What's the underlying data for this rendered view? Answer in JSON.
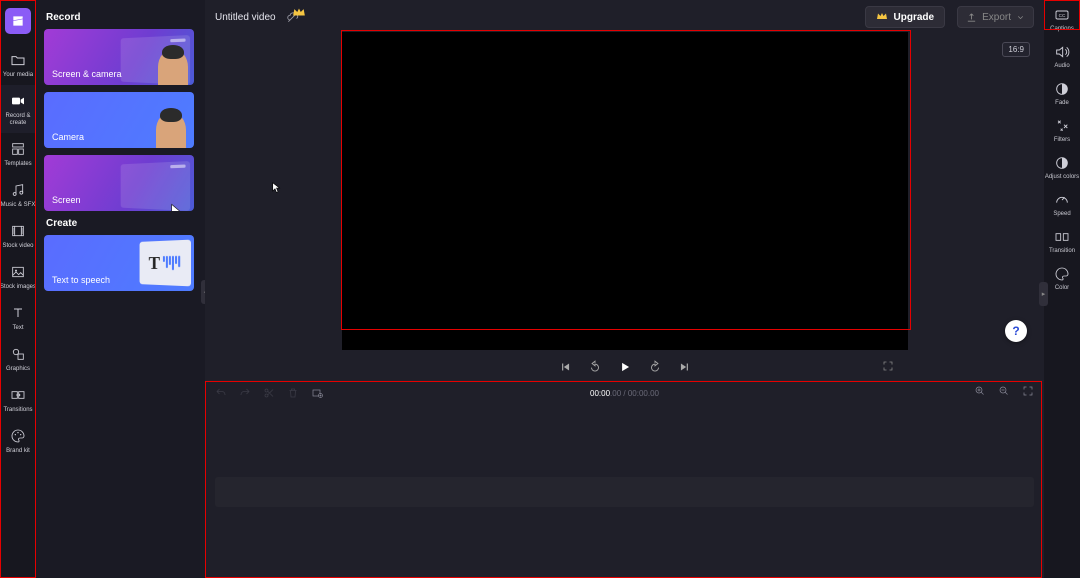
{
  "app": {
    "title": "Untitled video",
    "aspect_ratio": "16:9"
  },
  "actions": {
    "upgrade": "Upgrade",
    "export": "Export"
  },
  "leftnav": [
    {
      "id": "your-media",
      "label": "Your media"
    },
    {
      "id": "record-create",
      "label": "Record & create"
    },
    {
      "id": "templates",
      "label": "Templates"
    },
    {
      "id": "music-sfx",
      "label": "Music & SFX"
    },
    {
      "id": "stock-video",
      "label": "Stock video"
    },
    {
      "id": "stock-images",
      "label": "Stock images"
    },
    {
      "id": "text",
      "label": "Text"
    },
    {
      "id": "graphics",
      "label": "Graphics"
    },
    {
      "id": "transitions",
      "label": "Transitions"
    },
    {
      "id": "brand-kit",
      "label": "Brand kit"
    }
  ],
  "panel": {
    "section_record": "Record",
    "section_create": "Create",
    "cards": {
      "screen_camera": "Screen & camera",
      "camera": "Camera",
      "screen": "Screen",
      "tts": "Text to speech"
    }
  },
  "rightrail": [
    {
      "id": "captions",
      "label": "Captions"
    },
    {
      "id": "audio",
      "label": "Audio"
    },
    {
      "id": "fade",
      "label": "Fade"
    },
    {
      "id": "filters",
      "label": "Filters"
    },
    {
      "id": "adjust-colors",
      "label": "Adjust colors"
    },
    {
      "id": "speed",
      "label": "Speed"
    },
    {
      "id": "transition",
      "label": "Transition"
    },
    {
      "id": "color",
      "label": "Color"
    }
  ],
  "timecode": {
    "current_main": "00:00",
    "current_frac": ".00",
    "sep": " / ",
    "total_main": "00:00",
    "total_frac": ".00"
  },
  "help": "?"
}
